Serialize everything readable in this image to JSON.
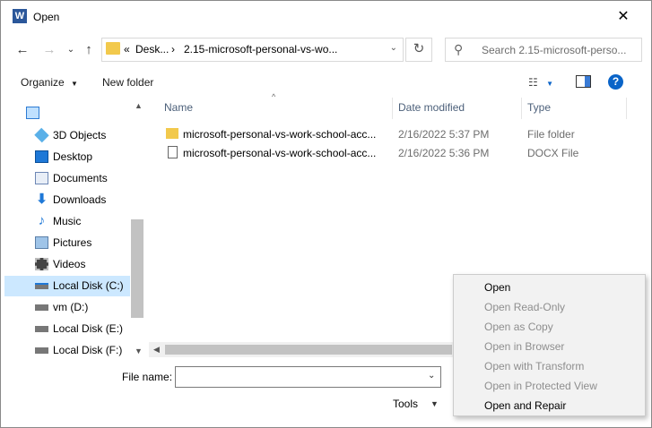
{
  "window": {
    "title": "Open",
    "app_icon": "W"
  },
  "nav_buttons": {
    "back": "←",
    "forward": "→",
    "up": "↑"
  },
  "address": {
    "prefix": "«",
    "segment1": "Desk...",
    "separator": "›",
    "segment2": "2.15-microsoft-personal-vs-wo..."
  },
  "search": {
    "placeholder": "Search 2.15-microsoft-perso..."
  },
  "toolbar": {
    "organize": "Organize",
    "new_folder": "New folder",
    "help": "?"
  },
  "sidebar": {
    "items": [
      {
        "label": "",
        "icon": "computer-icon"
      },
      {
        "label": "3D Objects",
        "icon": "3d-objects-icon"
      },
      {
        "label": "Desktop",
        "icon": "desktop-icon"
      },
      {
        "label": "Documents",
        "icon": "documents-icon"
      },
      {
        "label": "Downloads",
        "icon": "downloads-icon"
      },
      {
        "label": "Music",
        "icon": "music-icon"
      },
      {
        "label": "Pictures",
        "icon": "pictures-icon"
      },
      {
        "label": "Videos",
        "icon": "videos-icon"
      },
      {
        "label": "Local Disk (C:)",
        "icon": "drive-icon",
        "selected": true
      },
      {
        "label": "vm (D:)",
        "icon": "drive-icon"
      },
      {
        "label": "Local Disk (E:)",
        "icon": "drive-icon"
      },
      {
        "label": "Local Disk (F:)",
        "icon": "drive-icon"
      }
    ]
  },
  "columns": {
    "name": "Name",
    "date": "Date modified",
    "type": "Type"
  },
  "files": [
    {
      "name": "microsoft-personal-vs-work-school-acc...",
      "date": "2/16/2022 5:37 PM",
      "type": "File folder",
      "icon": "folder-icon"
    },
    {
      "name": "microsoft-personal-vs-work-school-acc...",
      "date": "2/16/2022 5:36 PM",
      "type": "DOCX File",
      "icon": "document-icon"
    }
  ],
  "footer": {
    "file_name_label": "File name:",
    "file_name_value": "",
    "tools_label": "Tools"
  },
  "open_menu": {
    "items": [
      {
        "label": "Open",
        "enabled": true
      },
      {
        "label": "Open Read-Only",
        "enabled": false
      },
      {
        "label": "Open as Copy",
        "enabled": false
      },
      {
        "label": "Open in Browser",
        "enabled": false
      },
      {
        "label": "Open with Transform",
        "enabled": false
      },
      {
        "label": "Open in Protected View",
        "enabled": false
      },
      {
        "label": "Open and Repair",
        "enabled": true
      }
    ]
  },
  "colors": {
    "accent": "#0a64c8",
    "selection": "#cce8ff",
    "folder": "#f2c94c",
    "word": "#2b579a"
  }
}
